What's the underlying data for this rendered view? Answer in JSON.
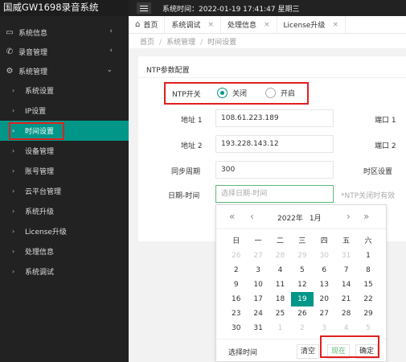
{
  "app": {
    "title": "国威GW1698录音系统",
    "system_time": "系统时间：2022-01-19 17:41:47 星期三"
  },
  "sidebar": {
    "groups": [
      {
        "label": "系统信息",
        "icon": "monitor-icon",
        "expanded": false
      },
      {
        "label": "录音管理",
        "icon": "phone-icon",
        "expanded": false
      },
      {
        "label": "系统管理",
        "icon": "gear-icon",
        "expanded": true
      }
    ],
    "items": [
      {
        "label": "系统设置"
      },
      {
        "label": "IP设置"
      },
      {
        "label": "时间设置",
        "active": true
      },
      {
        "label": "设备管理"
      },
      {
        "label": "账号管理"
      },
      {
        "label": "云平台管理"
      },
      {
        "label": "系统升级"
      },
      {
        "label": "License升级"
      },
      {
        "label": "处理信息"
      },
      {
        "label": "系统调试"
      }
    ]
  },
  "tabs": [
    {
      "label": "首页",
      "home": true
    },
    {
      "label": "系统调试"
    },
    {
      "label": "处理信息"
    },
    {
      "label": "License升级"
    }
  ],
  "breadcrumb": [
    "首页",
    "系统管理",
    "时间设置"
  ],
  "form": {
    "section_title": "NTP参数配置",
    "ntp_switch": {
      "label": "NTP开关",
      "options": [
        "关闭",
        "开启"
      ],
      "selected": "关闭"
    },
    "addr1": {
      "label": "地址 1",
      "value": "108.61.223.189"
    },
    "port1": {
      "label": "端口 1"
    },
    "addr2": {
      "label": "地址 2",
      "value": "193.228.143.12"
    },
    "port2": {
      "label": "端口 2"
    },
    "sync_period": {
      "label": "同步周期",
      "value": "300"
    },
    "timezone": {
      "label": "时区设置"
    },
    "datetime": {
      "label": "日期-时间",
      "placeholder": "选择日期-时间",
      "hint": "*NTP关闭时有效"
    }
  },
  "picker": {
    "year": "2022年",
    "month": "1月",
    "weekdays": [
      "日",
      "一",
      "二",
      "三",
      "四",
      "五",
      "六"
    ],
    "weeks": [
      [
        {
          "d": "26",
          "m": 1
        },
        {
          "d": "27",
          "m": 1
        },
        {
          "d": "28",
          "m": 1
        },
        {
          "d": "29",
          "m": 1
        },
        {
          "d": "30",
          "m": 1
        },
        {
          "d": "31",
          "m": 1
        },
        {
          "d": "1",
          "m": 0
        }
      ],
      [
        {
          "d": "2",
          "m": 0
        },
        {
          "d": "3",
          "m": 0
        },
        {
          "d": "4",
          "m": 0
        },
        {
          "d": "5",
          "m": 0
        },
        {
          "d": "6",
          "m": 0
        },
        {
          "d": "7",
          "m": 0
        },
        {
          "d": "8",
          "m": 0
        }
      ],
      [
        {
          "d": "9",
          "m": 0
        },
        {
          "d": "10",
          "m": 0
        },
        {
          "d": "11",
          "m": 0
        },
        {
          "d": "12",
          "m": 0
        },
        {
          "d": "13",
          "m": 0
        },
        {
          "d": "14",
          "m": 0
        },
        {
          "d": "15",
          "m": 0
        }
      ],
      [
        {
          "d": "16",
          "m": 0
        },
        {
          "d": "17",
          "m": 0
        },
        {
          "d": "18",
          "m": 0
        },
        {
          "d": "19",
          "m": 0,
          "sel": 1
        },
        {
          "d": "20",
          "m": 0
        },
        {
          "d": "21",
          "m": 0
        },
        {
          "d": "22",
          "m": 0
        }
      ],
      [
        {
          "d": "23",
          "m": 0
        },
        {
          "d": "24",
          "m": 0
        },
        {
          "d": "25",
          "m": 0
        },
        {
          "d": "26",
          "m": 0
        },
        {
          "d": "27",
          "m": 0
        },
        {
          "d": "28",
          "m": 0
        },
        {
          "d": "29",
          "m": 0
        }
      ],
      [
        {
          "d": "30",
          "m": 0
        },
        {
          "d": "31",
          "m": 0
        },
        {
          "d": "1",
          "m": 1
        },
        {
          "d": "2",
          "m": 1
        },
        {
          "d": "3",
          "m": 1
        },
        {
          "d": "4",
          "m": 1
        },
        {
          "d": "5",
          "m": 1
        }
      ]
    ],
    "footer": {
      "select_time": "选择时间",
      "clear": "清空",
      "now": "现在",
      "confirm": "确定"
    }
  },
  "colors": {
    "sidebar_bg": "#222222",
    "accent": "#009688",
    "highlight": "#e02020"
  }
}
